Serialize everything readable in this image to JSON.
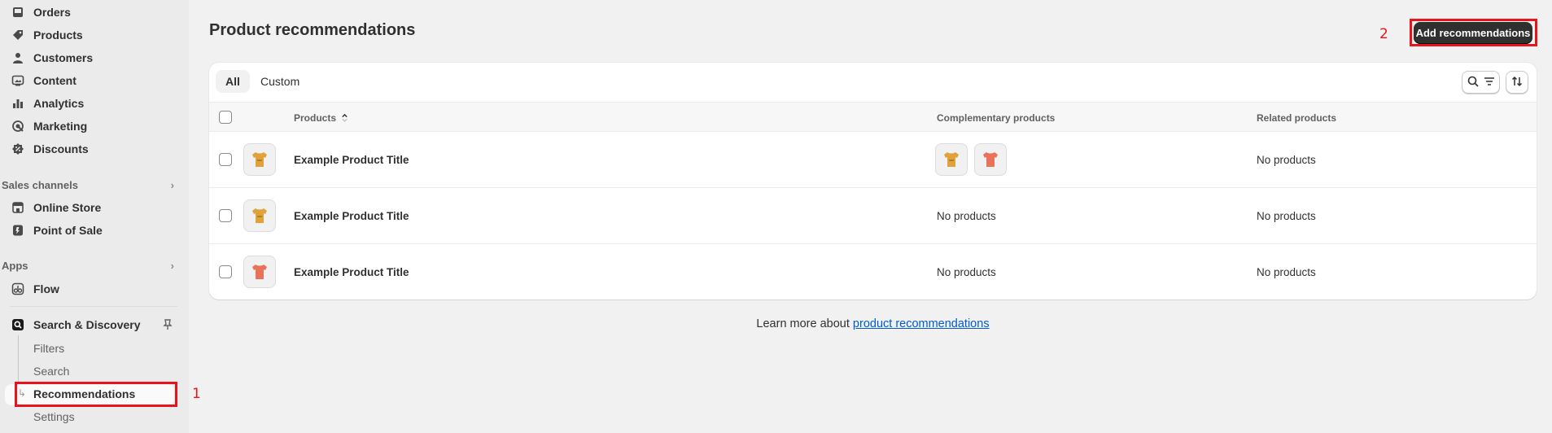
{
  "sidebar": {
    "items": [
      {
        "label": "Orders",
        "icon": "inbox-icon"
      },
      {
        "label": "Products",
        "icon": "tag-icon"
      },
      {
        "label": "Customers",
        "icon": "person-icon"
      },
      {
        "label": "Content",
        "icon": "image-icon"
      },
      {
        "label": "Analytics",
        "icon": "bar-chart-icon"
      },
      {
        "label": "Marketing",
        "icon": "target-icon"
      },
      {
        "label": "Discounts",
        "icon": "discount-icon"
      }
    ],
    "sales_channels": {
      "heading": "Sales channels",
      "items": [
        {
          "label": "Online Store",
          "icon": "store-icon"
        },
        {
          "label": "Point of Sale",
          "icon": "pos-icon"
        }
      ]
    },
    "apps": {
      "heading": "Apps",
      "items": [
        {
          "label": "Flow",
          "icon": "flow-icon"
        }
      ]
    },
    "app_search": {
      "label": "Search & Discovery",
      "subitems": [
        "Filters",
        "Search",
        "Recommendations",
        "Settings"
      ],
      "active": "Recommendations"
    }
  },
  "page": {
    "title": "Product recommendations",
    "primary_action": "Add recommendations"
  },
  "annotations": {
    "one": "1",
    "two": "2"
  },
  "tabs": [
    "All",
    "Custom"
  ],
  "table": {
    "columns": [
      "Products",
      "Complementary products",
      "Related products"
    ],
    "rows": [
      {
        "title": "Example Product Title",
        "thumb_color": "#e0a23a",
        "complementary": "",
        "related": "No products"
      },
      {
        "title": "Example Product Title",
        "thumb_color": "#e0a23a",
        "complementary": "No products",
        "related": "No products"
      },
      {
        "title": "Example Product Title",
        "thumb_color": "#e8735a",
        "complementary": "No products",
        "related": "No products"
      }
    ]
  },
  "footer": {
    "prefix": "Learn more about ",
    "link": "product recommendations"
  },
  "colors": {
    "accent_red": "#e8141b",
    "shirt_yellow": "#e0a23a",
    "shirt_coral": "#e8735a",
    "link": "#005bd3"
  }
}
